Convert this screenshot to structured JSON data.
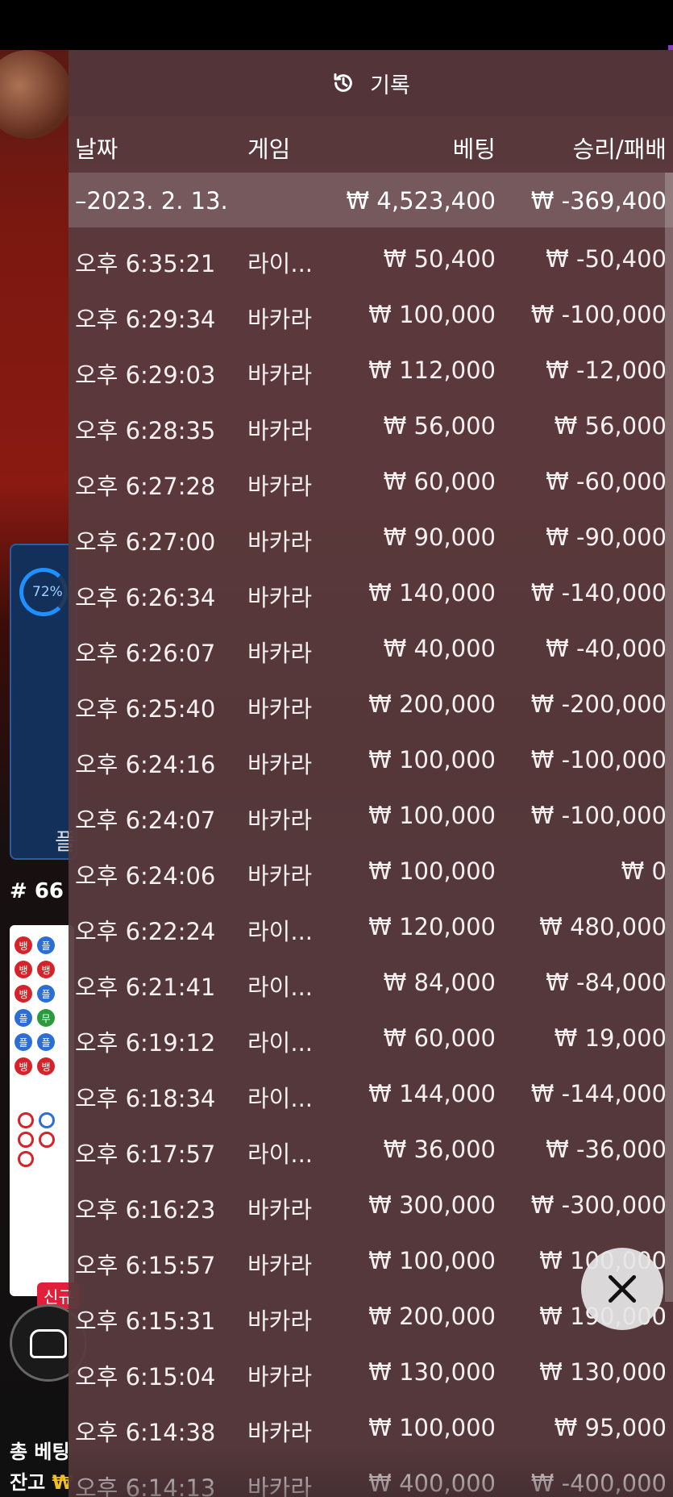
{
  "background": {
    "ring_percent": "72%",
    "panel_label": "플",
    "round_label": "# 66",
    "new_badge": "신규",
    "total_bet_label": "총 베팅",
    "balance_label": "잔고",
    "balance_symbol": "₩",
    "road_cells": [
      "뱅",
      "플",
      "뱅",
      "뱅",
      "뱅",
      "플",
      "플",
      "무",
      "플",
      "플",
      "뱅",
      "뱅"
    ]
  },
  "panel": {
    "title": "기록",
    "columns": {
      "date": "날짜",
      "game": "게임",
      "bet": "베팅",
      "result": "승리/패배"
    },
    "summary": {
      "date": "–2023. 2. 13.",
      "bet": "₩ 4,523,400",
      "result": "₩ -369,400"
    },
    "rows": [
      {
        "time": "오후 6:35:21",
        "game": "라이...",
        "bet": "₩ 50,400",
        "result": "₩ -50,400"
      },
      {
        "time": "오후 6:29:34",
        "game": "바카라",
        "bet": "₩ 100,000",
        "result": "₩ -100,000"
      },
      {
        "time": "오후 6:29:03",
        "game": "바카라",
        "bet": "₩ 112,000",
        "result": "₩ -12,000"
      },
      {
        "time": "오후 6:28:35",
        "game": "바카라",
        "bet": "₩ 56,000",
        "result": "₩ 56,000"
      },
      {
        "time": "오후 6:27:28",
        "game": "바카라",
        "bet": "₩ 60,000",
        "result": "₩ -60,000"
      },
      {
        "time": "오후 6:27:00",
        "game": "바카라",
        "bet": "₩ 90,000",
        "result": "₩ -90,000"
      },
      {
        "time": "오후 6:26:34",
        "game": "바카라",
        "bet": "₩ 140,000",
        "result": "₩ -140,000"
      },
      {
        "time": "오후 6:26:07",
        "game": "바카라",
        "bet": "₩ 40,000",
        "result": "₩ -40,000"
      },
      {
        "time": "오후 6:25:40",
        "game": "바카라",
        "bet": "₩ 200,000",
        "result": "₩ -200,000"
      },
      {
        "time": "오후 6:24:16",
        "game": "바카라",
        "bet": "₩ 100,000",
        "result": "₩ -100,000"
      },
      {
        "time": "오후 6:24:07",
        "game": "바카라",
        "bet": "₩ 100,000",
        "result": "₩ -100,000"
      },
      {
        "time": "오후 6:24:06",
        "game": "바카라",
        "bet": "₩ 100,000",
        "result": "₩ 0"
      },
      {
        "time": "오후 6:22:24",
        "game": "라이...",
        "bet": "₩ 120,000",
        "result": "₩ 480,000"
      },
      {
        "time": "오후 6:21:41",
        "game": "라이...",
        "bet": "₩ 84,000",
        "result": "₩ -84,000"
      },
      {
        "time": "오후 6:19:12",
        "game": "라이...",
        "bet": "₩ 60,000",
        "result": "₩ 19,000"
      },
      {
        "time": "오후 6:18:34",
        "game": "라이...",
        "bet": "₩ 144,000",
        "result": "₩ -144,000"
      },
      {
        "time": "오후 6:17:57",
        "game": "라이...",
        "bet": "₩ 36,000",
        "result": "₩ -36,000"
      },
      {
        "time": "오후 6:16:23",
        "game": "바카라",
        "bet": "₩ 300,000",
        "result": "₩ -300,000"
      },
      {
        "time": "오후 6:15:57",
        "game": "바카라",
        "bet": "₩ 100,000",
        "result": "₩ 100,000"
      },
      {
        "time": "오후 6:15:31",
        "game": "바카라",
        "bet": "₩ 200,000",
        "result": "₩ 190,000"
      },
      {
        "time": "오후 6:15:04",
        "game": "바카라",
        "bet": "₩ 130,000",
        "result": "₩ 130,000"
      },
      {
        "time": "오후 6:14:38",
        "game": "바카라",
        "bet": "₩ 100,000",
        "result": "₩ 95,000"
      },
      {
        "time": "오후 6:14:13",
        "game": "바카라",
        "bet": "₩ 400,000",
        "result": "₩ -400,000"
      }
    ]
  },
  "icons": {
    "title": "history-icon",
    "close": "close-icon"
  }
}
